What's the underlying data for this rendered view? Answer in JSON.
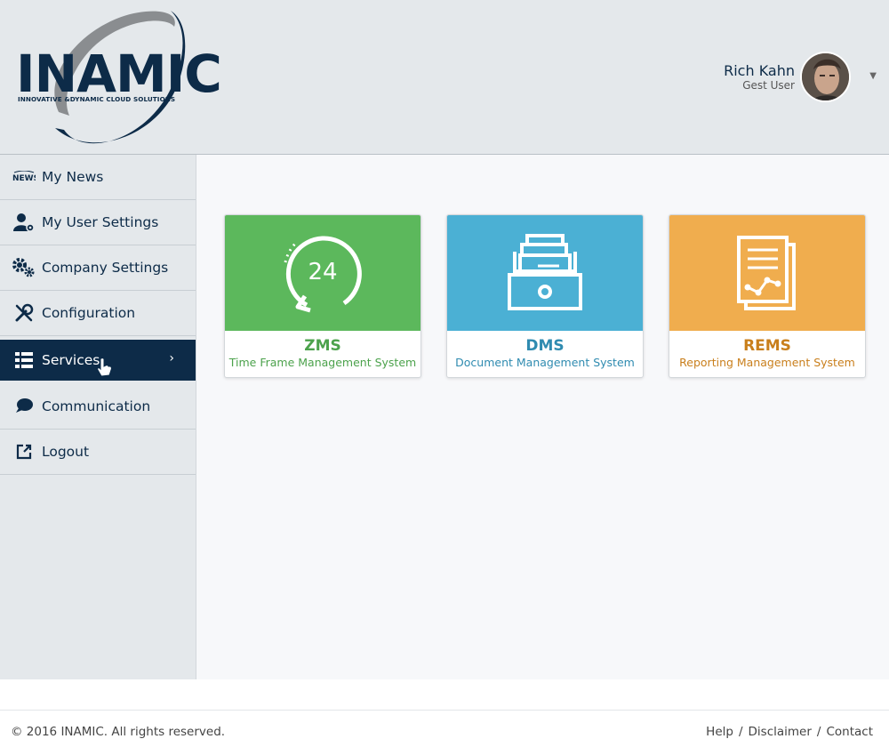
{
  "brand": {
    "name": "INAMIC",
    "tagline": "INNOVATIVE &DYNAMIC CLOUD SOLUTIONS",
    "primary_color": "#0d2b48"
  },
  "user": {
    "name": "Rich Kahn",
    "role": "Gest User"
  },
  "sidebar": {
    "items": [
      {
        "label": "My News",
        "icon": "news-icon"
      },
      {
        "label": "My User Settings",
        "icon": "user-settings-icon"
      },
      {
        "label": "Company Settings",
        "icon": "gears-icon"
      },
      {
        "label": "Configuration",
        "icon": "wrench-screwdriver-icon"
      },
      {
        "label": "Services",
        "icon": "list-icon",
        "active": true
      },
      {
        "label": "Communication",
        "icon": "chat-bubbles-icon"
      },
      {
        "label": "Logout",
        "icon": "external-link-icon"
      }
    ]
  },
  "services": [
    {
      "code": "ZMS",
      "name": "Time Frame Management System",
      "icon": "clock-24-icon",
      "color": "#5cb85c",
      "text_color": "#4ca24c"
    },
    {
      "code": "DMS",
      "name": "Document Management System",
      "icon": "archive-drawer-icon",
      "color": "#4bb0d4",
      "text_color": "#2f8bb0"
    },
    {
      "code": "REMS",
      "name": "Reporting Management System",
      "icon": "report-chart-icon",
      "color": "#f0ad4e",
      "text_color": "#c97f1c"
    }
  ],
  "footer": {
    "copyright": "© 2016 INAMIC. All rights reserved.",
    "help": "Help",
    "disclaimer": "Disclaimer",
    "contact": "Contact",
    "separator": "/"
  }
}
